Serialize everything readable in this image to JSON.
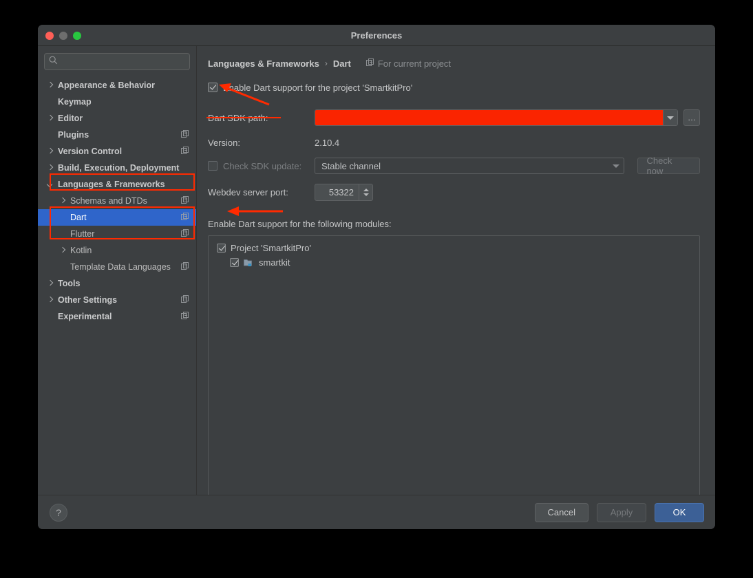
{
  "window": {
    "title": "Preferences",
    "traffic_lights": [
      "close-red",
      "minimize-gray",
      "zoom-green"
    ]
  },
  "sidebar": {
    "search": {
      "value": "",
      "placeholder": "",
      "icon": "search-icon"
    },
    "items": [
      {
        "label": "Appearance & Behavior",
        "level": 0,
        "arrow": "right",
        "bold": true,
        "scope_icon": false,
        "selected": false
      },
      {
        "label": "Keymap",
        "level": 0,
        "arrow": "none",
        "bold": true,
        "scope_icon": false,
        "selected": false
      },
      {
        "label": "Editor",
        "level": 0,
        "arrow": "right",
        "bold": true,
        "scope_icon": false,
        "selected": false
      },
      {
        "label": "Plugins",
        "level": 0,
        "arrow": "none",
        "bold": true,
        "scope_icon": true,
        "selected": false
      },
      {
        "label": "Version Control",
        "level": 0,
        "arrow": "right",
        "bold": true,
        "scope_icon": true,
        "selected": false
      },
      {
        "label": "Build, Execution, Deployment",
        "level": 0,
        "arrow": "right",
        "bold": true,
        "scope_icon": false,
        "selected": false
      },
      {
        "label": "Languages & Frameworks",
        "level": 0,
        "arrow": "down",
        "bold": true,
        "scope_icon": false,
        "selected": false
      },
      {
        "label": "Schemas and DTDs",
        "level": 1,
        "arrow": "right",
        "bold": false,
        "scope_icon": true,
        "selected": false
      },
      {
        "label": "Dart",
        "level": 1,
        "arrow": "none",
        "bold": false,
        "scope_icon": true,
        "selected": true
      },
      {
        "label": "Flutter",
        "level": 1,
        "arrow": "none",
        "bold": false,
        "scope_icon": true,
        "selected": false
      },
      {
        "label": "Kotlin",
        "level": 1,
        "arrow": "right",
        "bold": false,
        "scope_icon": false,
        "selected": false
      },
      {
        "label": "Template Data Languages",
        "level": 1,
        "arrow": "none",
        "bold": false,
        "scope_icon": true,
        "selected": false
      },
      {
        "label": "Tools",
        "level": 0,
        "arrow": "right",
        "bold": true,
        "scope_icon": false,
        "selected": false
      },
      {
        "label": "Other Settings",
        "level": 0,
        "arrow": "right",
        "bold": true,
        "scope_icon": true,
        "selected": false
      },
      {
        "label": "Experimental",
        "level": 0,
        "arrow": "none",
        "bold": true,
        "scope_icon": true,
        "selected": false
      }
    ]
  },
  "main": {
    "breadcrumb": {
      "parent": "Languages & Frameworks",
      "separator": "›",
      "current": "Dart",
      "scope_label": "For current project",
      "scope_icon": "project-scope-icon"
    },
    "enable_support": {
      "label": "Enable Dart support for the project 'SmartkitPro'",
      "checked": true
    },
    "sdk_path": {
      "label": "Dart SDK path:",
      "value": "",
      "redacted": true,
      "redaction_color": "#fa2400",
      "dropdown_icon": "chevron-down-icon",
      "browse_label": "…"
    },
    "version": {
      "label": "Version:",
      "value": "2.10.4"
    },
    "check_sdk_update": {
      "label": "Check SDK update:",
      "checked": false,
      "disabled": true,
      "channel_value": "Stable channel",
      "check_now_label": "Check now",
      "check_now_disabled": true
    },
    "webdev_port": {
      "label": "Webdev server port:",
      "value": "53322"
    },
    "modules": {
      "title": "Enable Dart support for the following modules:",
      "rows": [
        {
          "label": "Project 'SmartkitPro'",
          "level": 0,
          "checked": true,
          "icon": "none"
        },
        {
          "label": "smartkit",
          "level": 1,
          "checked": true,
          "icon": "module-folder-icon"
        }
      ]
    }
  },
  "footer": {
    "help_label": "?",
    "cancel_label": "Cancel",
    "apply_label": "Apply",
    "apply_disabled": true,
    "ok_label": "OK"
  },
  "annotations": {
    "color": "#ff2a00",
    "highlight_boxes": [
      "languages-frameworks-sidebar-item",
      "dart-flutter-sidebar-items"
    ],
    "arrows": [
      "arrow-to-enable-dart-checkbox",
      "arrow-to-project-modules-checkbox"
    ],
    "underlines": [
      "dart-sdk-path-label-underline"
    ]
  },
  "colors": {
    "window_bg": "#3c3f41",
    "selection_blue": "#2f65ca",
    "primary_button": "#3c6096",
    "annotation_red": "#ff2a00",
    "redaction_red": "#fa2400"
  }
}
